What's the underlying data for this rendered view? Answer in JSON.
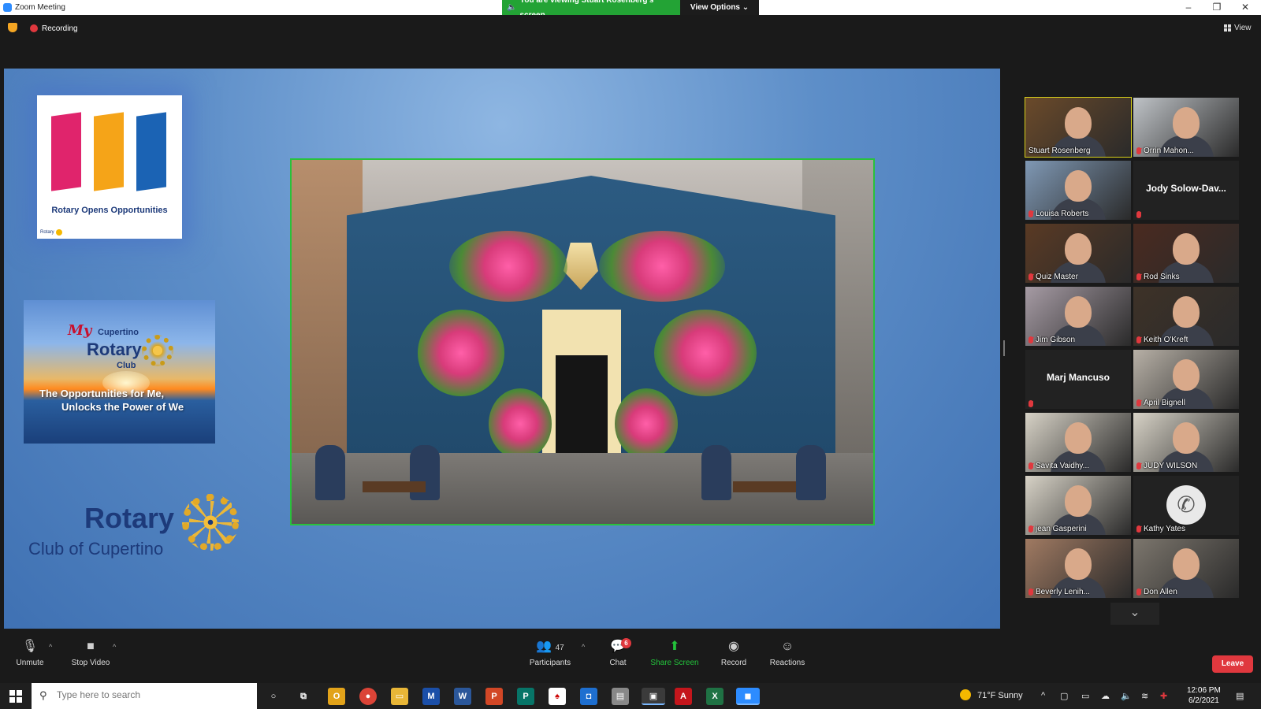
{
  "window": {
    "title": "Zoom Meeting"
  },
  "share_banner": {
    "status": "You are viewing Stuart Rosenberg's screen",
    "view_options": "View Options"
  },
  "topbar": {
    "recording": "Recording",
    "view": "View"
  },
  "slide": {
    "logo_text": "Rotary Opens Opportunities",
    "logo_small": "Rotary",
    "club_my": "My",
    "club_cupertino": "Cupertino",
    "club_rotary": "Rotary",
    "club_club": "Club",
    "club_tag1": "The Opportunities for Me,",
    "club_tag2": "Unlocks the Power of We",
    "rotary_word": "Rotary",
    "rotary_sub": "Club of Cupertino",
    "door_colors": [
      "#e0246c",
      "#f5a418",
      "#1b63b4"
    ]
  },
  "participants_tiles": [
    {
      "name": "Stuart Rosenberg",
      "active": true,
      "muted": false,
      "bg": "#6b4a2a"
    },
    {
      "name": "Orrin Mahon...",
      "muted": true,
      "bg": "#bfc3c7"
    },
    {
      "name": "Louisa Roberts",
      "muted": true,
      "bg": "#7f98b4"
    },
    {
      "name": "Jody  Solow-Dav...",
      "muted": true,
      "video": false
    },
    {
      "name": "Quiz Master",
      "muted": true,
      "bg": "#5a3a24"
    },
    {
      "name": "Rod Sinks",
      "muted": true,
      "bg": "#4a2a20"
    },
    {
      "name": "Jim Gibson",
      "muted": true,
      "bg": "#a69ba4"
    },
    {
      "name": "Keith O'Kreft",
      "muted": true,
      "bg": "#3e3228"
    },
    {
      "name": "Marj Mancuso",
      "muted": true,
      "video": false
    },
    {
      "name": "April Bignell",
      "muted": true,
      "bg": "#b7b0a6"
    },
    {
      "name": "Savita Vaidhy...",
      "muted": true,
      "bg": "#d7d2c6"
    },
    {
      "name": "JUDY WILSON",
      "muted": true,
      "bg": "#d7d2c6"
    },
    {
      "name": "jean Gasperini",
      "muted": true,
      "bg": "#d7d2c6"
    },
    {
      "name": "Kathy Yates",
      "muted": true,
      "phone": true
    },
    {
      "name": "Beverly Lenih...",
      "muted": true,
      "bg": "#a07a62"
    },
    {
      "name": "Don Allen",
      "muted": true,
      "bg": "#7c766d"
    }
  ],
  "toolbar": {
    "unmute": "Unmute",
    "stop_video": "Stop Video",
    "participants_count": "47",
    "participants": "Participants",
    "chat_badge": "6",
    "chat": "Chat",
    "share_screen": "Share Screen",
    "record": "Record",
    "reactions": "Reactions",
    "leave": "Leave"
  },
  "taskbar": {
    "search_placeholder": "Type here to search",
    "weather": "71°F  Sunny",
    "time": "12:06 PM",
    "date": "6/2/2021"
  }
}
